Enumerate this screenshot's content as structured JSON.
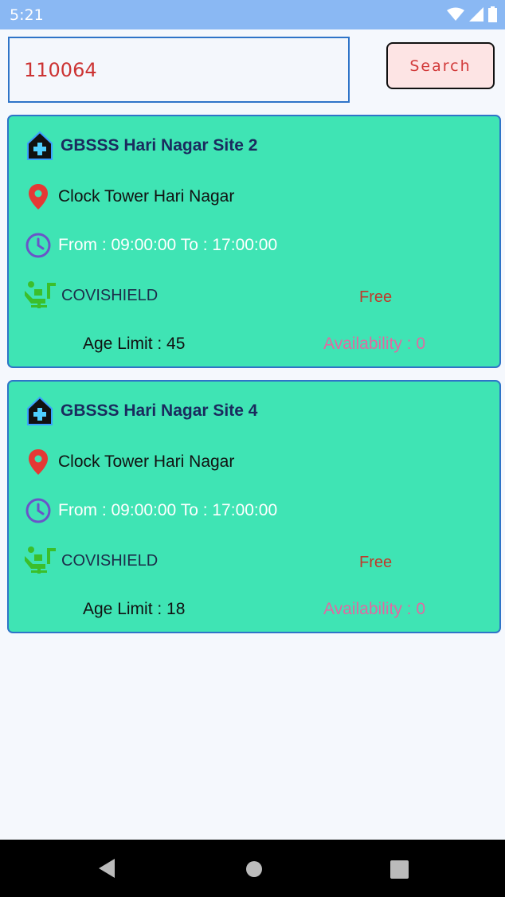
{
  "status_bar": {
    "time": "5:21",
    "icons": [
      "wifi-icon",
      "signal-icon",
      "battery-icon"
    ]
  },
  "search": {
    "value": "110064",
    "button_label": "Search"
  },
  "centers": [
    {
      "name": "GBSSS Hari Nagar Site 2",
      "address": "Clock Tower Hari Nagar",
      "timing": "From : 09:00:00 To : 17:00:00",
      "vaccine": "COVISHIELD",
      "fee_type": "Free",
      "age_limit": "Age Limit : 45",
      "availability": "Availability : 0"
    },
    {
      "name": "GBSSS Hari Nagar Site 4",
      "address": "Clock Tower Hari Nagar",
      "timing": "From : 09:00:00 To : 17:00:00",
      "vaccine": "COVISHIELD",
      "fee_type": "Free",
      "age_limit": "Age Limit : 18",
      "availability": "Availability : 0"
    }
  ],
  "colors": {
    "card_background": "#3fe4b4",
    "card_border": "#2f74c8",
    "status_bar": "#8ab8f3",
    "search_text": "#cc3333",
    "button_background": "#fde4e4"
  },
  "nav_bar": {
    "buttons": [
      "back-icon",
      "home-icon",
      "recents-icon"
    ]
  }
}
